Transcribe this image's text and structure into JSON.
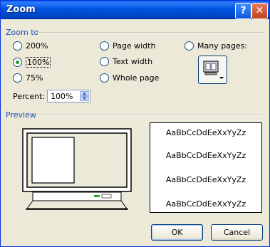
{
  "window": {
    "title": "Zoom"
  },
  "titlebar": {
    "help_label": "?",
    "close_label": "✕"
  },
  "zoom_to": {
    "label": "Zoom to",
    "options": [
      {
        "label": "200%",
        "selected": false
      },
      {
        "label": "100%",
        "selected": true
      },
      {
        "label": "75%",
        "selected": false
      },
      {
        "label": "Page width",
        "selected": false
      },
      {
        "label": "Text width",
        "selected": false
      },
      {
        "label": "Whole page",
        "selected": false
      },
      {
        "label": "Many pages:",
        "selected": false
      }
    ],
    "many_pages_icon": "monitor-pages-icon"
  },
  "percent": {
    "label": "Percent:",
    "value": "100%"
  },
  "preview": {
    "label": "Preview",
    "sample_lines": [
      "AaBbCcDdEeXxYyZz",
      "AaBbCcDdEeXxYyZz",
      "AaBbCcDdEeXxYyZz",
      "AaBbCcDdEeXxYyZz"
    ]
  },
  "buttons": {
    "ok": "OK",
    "cancel": "Cancel"
  }
}
